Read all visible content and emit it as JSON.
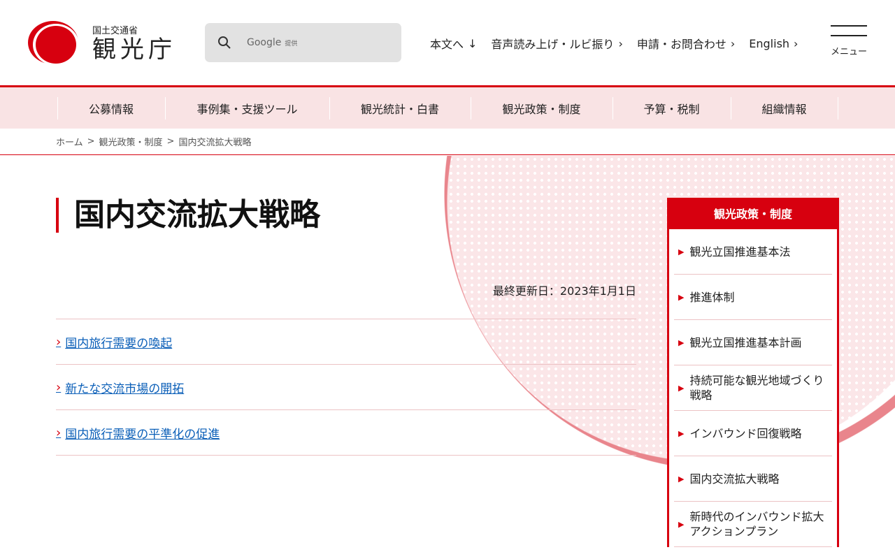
{
  "header": {
    "org": "国土交通省",
    "agency": "観光庁",
    "search_placeholder": "Google",
    "search_provider": "提供",
    "topnav": [
      {
        "label": "本文へ",
        "icon": "arrow-down-icon"
      },
      {
        "label": "音声読み上げ・ルビ振り",
        "icon": "chevron-right-icon"
      },
      {
        "label": "申請・お問合わせ",
        "icon": "chevron-right-icon"
      },
      {
        "label": "English",
        "icon": "chevron-right-icon"
      }
    ],
    "menu_label": "メニュー"
  },
  "gnav": [
    "公募情報",
    "事例集・支援ツール",
    "観光統計・白書",
    "観光政策・制度",
    "予算・税制",
    "組織情報"
  ],
  "breadcrumb": [
    "ホーム",
    "観光政策・制度",
    "国内交流拡大戦略"
  ],
  "page": {
    "title": "国内交流拡大戦略",
    "updated": "最終更新日：2023年1月1日",
    "links": [
      "国内旅行需要の喚起",
      "新たな交流市場の開拓",
      "国内旅行需要の平準化の促進"
    ]
  },
  "sidebar": {
    "title": "観光政策・制度",
    "items": [
      "観光立国推進基本法",
      "推進体制",
      "観光立国推進基本計画",
      "持続可能な観光地域づくり戦略",
      "インバウンド回復戦略",
      "国内交流拡大戦略",
      "新時代のインバウンド拡大アクションプラン"
    ]
  }
}
